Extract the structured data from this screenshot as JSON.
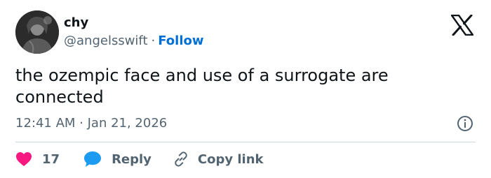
{
  "author": {
    "display_name": "chy",
    "handle": "@angelsswift",
    "separator": "·",
    "follow_label": "Follow"
  },
  "tweet": {
    "text": "the ozempic face and use of a surrogate are connected",
    "timestamp": "12:41 AM · Jan 21, 2026"
  },
  "actions": {
    "like_count": "17",
    "reply_label": "Reply",
    "copy_link_label": "Copy link"
  },
  "icons": {
    "brand": "x-logo-icon",
    "info": "info-icon",
    "like": "heart-icon",
    "reply": "speech-bubble-icon",
    "copy": "link-icon"
  },
  "colors": {
    "link_blue": "#006fd6",
    "secondary_text": "#536471",
    "heart_red": "#f91880",
    "reply_blue": "#1d9bf0",
    "divider": "#cfd9de"
  }
}
